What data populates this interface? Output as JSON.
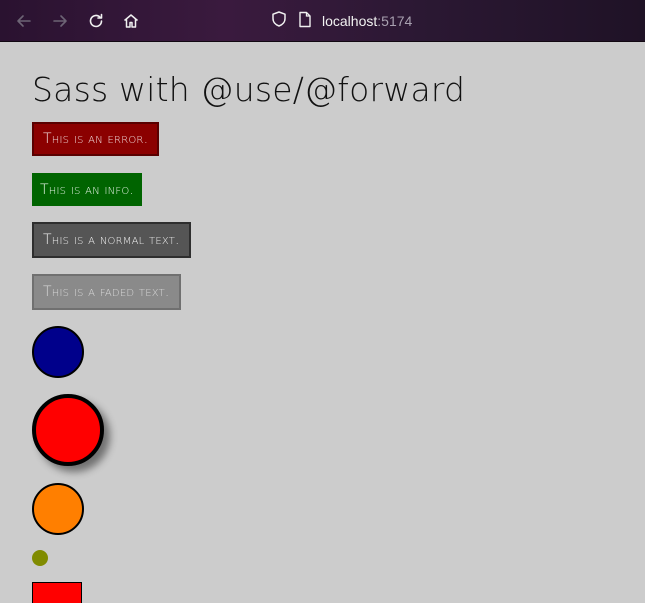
{
  "browser": {
    "url_host": "localhost",
    "url_port": ":5174",
    "icons": [
      "back-arrow-icon",
      "forward-arrow-icon",
      "reload-icon",
      "home-icon",
      "shield-icon",
      "page-icon"
    ]
  },
  "page": {
    "title": "Sass with @use/@forward",
    "messages": {
      "error": "This is an error.",
      "info": "This is an info.",
      "normal": "This is a normal text.",
      "faded": "This is a faded text."
    }
  },
  "colors": {
    "background": "#cccccc",
    "error": "#8b0000",
    "info": "#006400",
    "normal": "#555555",
    "faded": "#8a8a8a",
    "circle_blue": "#00008b",
    "circle_red": "#ff0000",
    "circle_orange": "#ff7f00",
    "dot_olive": "#808b00",
    "square_red": "#ff0000"
  }
}
